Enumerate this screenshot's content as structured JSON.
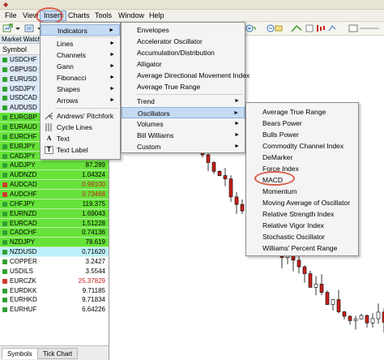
{
  "menubar": {
    "items": [
      {
        "label": "File"
      },
      {
        "label": "View"
      },
      {
        "label": "Insert"
      },
      {
        "label": "Charts"
      },
      {
        "label": "Tools"
      },
      {
        "label": "Window"
      },
      {
        "label": "Help"
      }
    ]
  },
  "market_watch": {
    "title": "Market Watch:",
    "column_symbol": "Symbol",
    "rows": [
      {
        "symbol": "USDCHF",
        "bid": "",
        "bg": "#dbe7f6"
      },
      {
        "symbol": "GBPUSD",
        "bid": "",
        "bg": "#dbe7f6"
      },
      {
        "symbol": "EURUSD",
        "bid": "",
        "bg": "#dbe7f6"
      },
      {
        "symbol": "USDJPY",
        "bid": "",
        "bg": "#dbe7f6"
      },
      {
        "symbol": "USDCAD",
        "bid": "",
        "bg": "#dbe7f6"
      },
      {
        "symbol": "AUDUSD",
        "bid": "",
        "bg": "#dbe7f6"
      },
      {
        "symbol": "EURGBP",
        "bid": "",
        "bg": "#66e23a"
      },
      {
        "symbol": "EURAUD",
        "bid": "",
        "bg": "#66e23a"
      },
      {
        "symbol": "EURCHF",
        "bid": "",
        "bg": "#66e23a"
      },
      {
        "symbol": "EURJPY",
        "bid": "",
        "bg": "#66e23a"
      },
      {
        "symbol": "CADJPY",
        "bid": "85.283",
        "bg": "#66e23a"
      },
      {
        "symbol": "AUDJPY",
        "bid": "87.289",
        "bg": "#66e23a"
      },
      {
        "symbol": "AUDNZD",
        "bid": "1.04324",
        "bg": "#66e23a"
      },
      {
        "symbol": "AUDCAD",
        "bid": "0.99100",
        "bg": "#66e23a",
        "red": true
      },
      {
        "symbol": "AUDCHF",
        "bid": "0.73468",
        "bg": "#66e23a",
        "red": true
      },
      {
        "symbol": "CHFJPY",
        "bid": "119.375",
        "bg": "#66e23a"
      },
      {
        "symbol": "EURNZD",
        "bid": "1.69043",
        "bg": "#66e23a"
      },
      {
        "symbol": "EURCAD",
        "bid": "1.51228",
        "bg": "#66e23a"
      },
      {
        "symbol": "CADCHF",
        "bid": "0.74136",
        "bg": "#66e23a"
      },
      {
        "symbol": "NZDJPY",
        "bid": "78.619",
        "bg": "#66e23a"
      },
      {
        "symbol": "NZDUSD",
        "bid": "0.71620",
        "bg": "#bdf0f7"
      },
      {
        "symbol": "COPPER",
        "bid": "3.2427",
        "bg": "#ffffff"
      },
      {
        "symbol": "USDILS",
        "bid": "3.5544",
        "bg": "#ffffff"
      },
      {
        "symbol": "EURCZK",
        "bid": "25.37829",
        "bg": "#ffffff",
        "red": true
      },
      {
        "symbol": "EURDKK",
        "bid": "9.71185",
        "bg": "#ffffff"
      },
      {
        "symbol": "EURHKD",
        "bid": "9.71834",
        "bg": "#ffffff"
      },
      {
        "symbol": "EURHUF",
        "bid": "6.64226",
        "bg": "#ffffff"
      }
    ]
  },
  "bottom_tabs": [
    "Symbols",
    "Tick Chart"
  ],
  "insert_menu": {
    "items": [
      {
        "label": "Indicators",
        "submenu": true,
        "highlighted": true
      },
      {
        "label": "Lines",
        "submenu": true
      },
      {
        "label": "Channels",
        "submenu": true
      },
      {
        "label": "Gann",
        "submenu": true
      },
      {
        "label": "Fibonacci",
        "submenu": true
      },
      {
        "label": "Shapes",
        "submenu": true
      },
      {
        "label": "Arrows",
        "submenu": true
      },
      {
        "label": "Andrews' Pitchfork"
      },
      {
        "label": "Cycle Lines"
      },
      {
        "label": "Text"
      },
      {
        "label": "Text Label"
      }
    ]
  },
  "indicators_menu": {
    "items": [
      {
        "label": "Envelopes"
      },
      {
        "label": "Accelerator Oscillator"
      },
      {
        "label": "Accumulation/Distribution"
      },
      {
        "label": "Alligator"
      },
      {
        "label": "Average Directional Movement Index"
      },
      {
        "label": "Average True Range"
      },
      {
        "label": "Trend",
        "submenu": true
      },
      {
        "label": "Oscillators",
        "submenu": true,
        "highlighted": true
      },
      {
        "label": "Volumes",
        "submenu": true
      },
      {
        "label": "Bill Williams",
        "submenu": true
      },
      {
        "label": "Custom",
        "submenu": true
      }
    ]
  },
  "oscillators_menu": {
    "items": [
      {
        "label": "Average True Range"
      },
      {
        "label": "Bears Power"
      },
      {
        "label": "Bulls Power"
      },
      {
        "label": "Commodity Channel Index"
      },
      {
        "label": "DeMarker"
      },
      {
        "label": "Force Index"
      },
      {
        "label": "MACD"
      },
      {
        "label": "Momentum"
      },
      {
        "label": "Moving Average of Oscillator"
      },
      {
        "label": "Relative Strength Index"
      },
      {
        "label": "Relative Vigor Index"
      },
      {
        "label": "Stochastic Oscillator"
      },
      {
        "label": "Williams' Percent Range"
      }
    ]
  },
  "colors": {
    "bull_candle": "#ffffff",
    "bear_candle": "#c8211a",
    "annotation": "#d9604f",
    "menu_highlight": "#c5dbf3"
  }
}
